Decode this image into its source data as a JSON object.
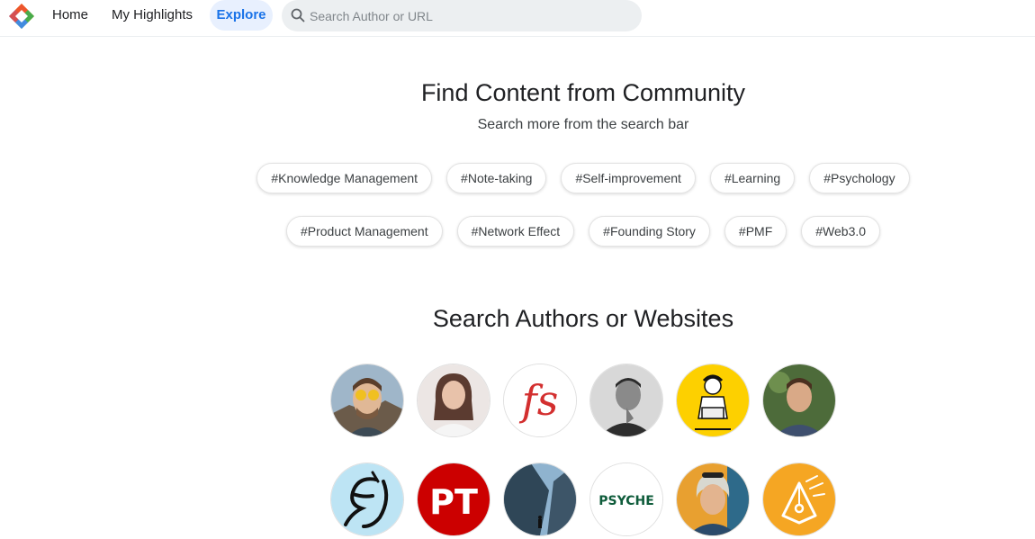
{
  "nav": {
    "home": "Home",
    "highlights": "My Highlights",
    "explore": "Explore"
  },
  "search": {
    "placeholder": "Search Author or URL"
  },
  "community": {
    "title": "Find Content from Community",
    "subtitle": "Search more from the search bar"
  },
  "tags_row1": [
    "#Knowledge Management",
    "#Note-taking",
    "#Self-improvement",
    "#Learning",
    "#Psychology"
  ],
  "tags_row2": [
    "#Product Management",
    "#Network Effect",
    "#Founding Story",
    "#PMF",
    "#Web3.0"
  ],
  "authors": {
    "title": "Search Authors or Websites",
    "logo_fs": "fs",
    "logo_pt": "PT",
    "logo_psyche": "PSYCHE"
  },
  "colors": {
    "accent": "#1a73e8",
    "fs_red": "#d32f2f",
    "pt_red": "#cc0000",
    "yellow": "#fdd000",
    "orange": "#f5a623",
    "psyche_green": "#0f5c3b"
  }
}
